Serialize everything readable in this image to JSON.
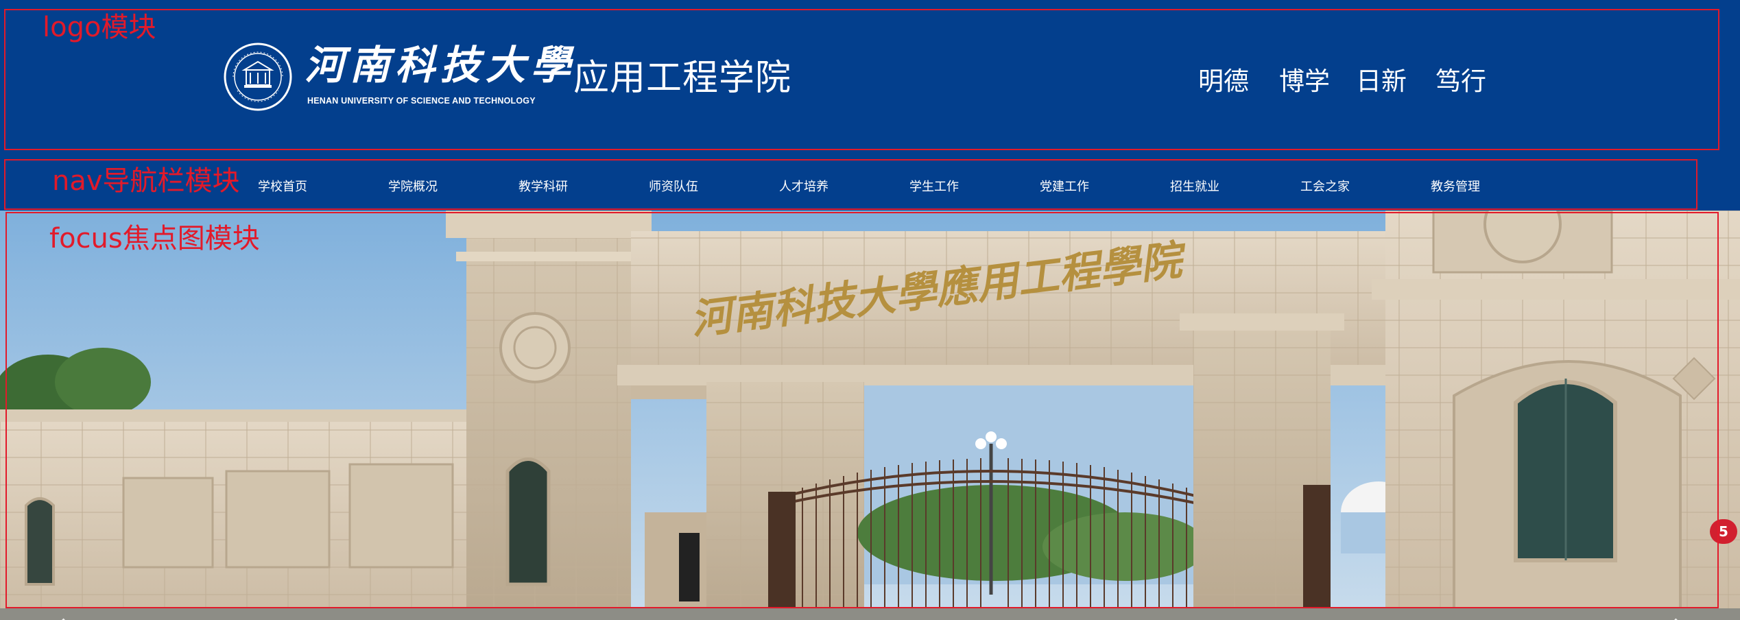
{
  "annotations": {
    "logo": "logo模块",
    "nav": "nav导航栏模块",
    "focus": "focus焦点图模块"
  },
  "header": {
    "school_name_cn": "河南科技大學",
    "school_name_en": "HENAN UNIVERSITY OF SCIENCE AND TECHNOLOGY",
    "college_name": "应用工程学院",
    "motto": [
      "明德",
      "博学",
      "日新",
      "笃行"
    ]
  },
  "nav": {
    "items": [
      "学校首页",
      "学院概况",
      "教学科研",
      "师资队伍",
      "人才培养",
      "学生工作",
      "党建工作",
      "招生就业",
      "工会之家",
      "教务管理"
    ]
  },
  "focus": {
    "gate_inscription": "河南科技大學應用工程學院",
    "prev_icon": "chevron-left-icon",
    "next_icon": "chevron-right-icon",
    "side_badge": "5"
  },
  "colors": {
    "brand_blue": "#033f8d",
    "annotation_red": "#e21a2a"
  }
}
